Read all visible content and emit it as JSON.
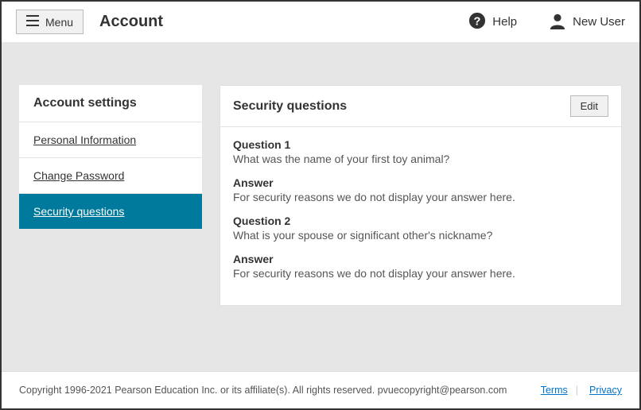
{
  "topbar": {
    "menu_label": "Menu",
    "page_title": "Account",
    "help_label": "Help",
    "user_label": "New User"
  },
  "sidebar": {
    "title": "Account settings",
    "items": [
      {
        "label": "Personal Information"
      },
      {
        "label": "Change Password"
      },
      {
        "label": "Security questions"
      }
    ]
  },
  "main": {
    "title": "Security questions",
    "edit_label": "Edit",
    "questions": [
      {
        "q_label": "Question 1",
        "q_text": "What was the name of your first toy animal?",
        "a_label": "Answer",
        "a_text": "For security reasons we do not display your answer here."
      },
      {
        "q_label": "Question 2",
        "q_text": "What is your spouse or significant other's nickname?",
        "a_label": "Answer",
        "a_text": "For security reasons we do not display your answer here."
      }
    ]
  },
  "footer": {
    "copyright": "Copyright 1996-2021 Pearson Education Inc. or its affiliate(s). All rights reserved. pvuecopyright@pearson.com",
    "terms_label": "Terms ",
    "privacy_label": "Privacy"
  }
}
